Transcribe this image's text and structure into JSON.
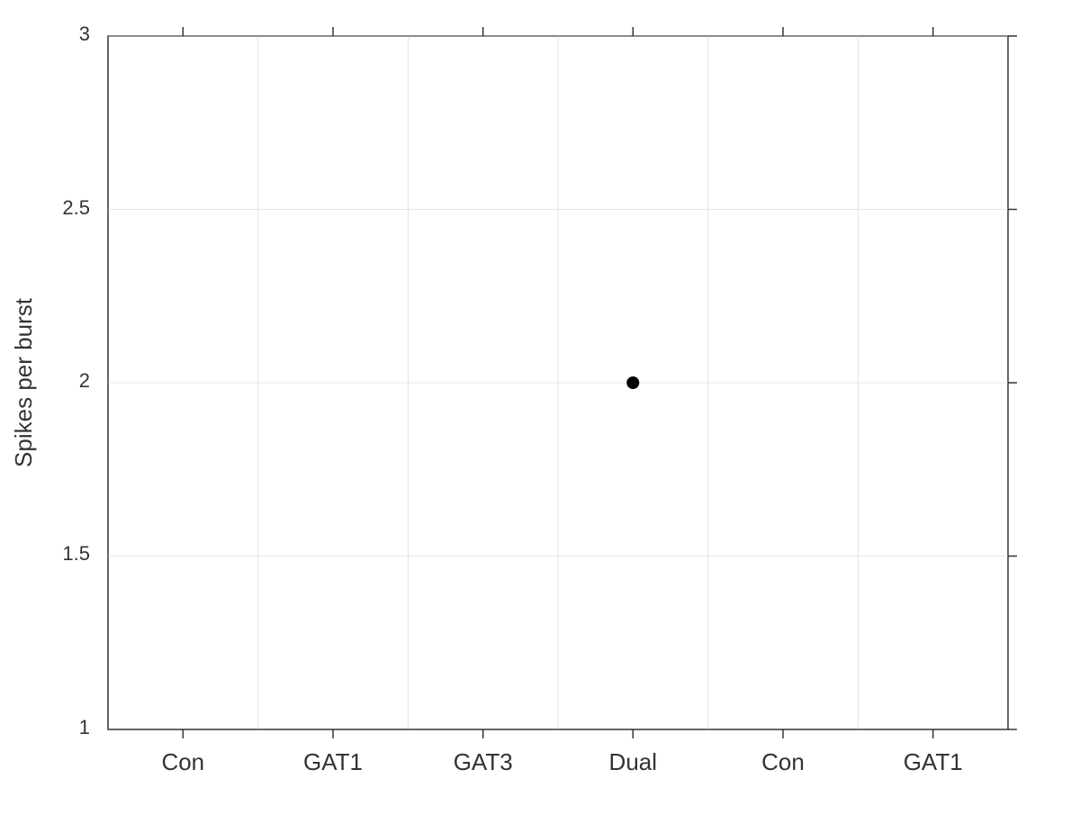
{
  "chart": {
    "title": "",
    "y_axis_label": "Spikes per burst",
    "x_axis_labels": [
      "Con",
      "GAT1",
      "GAT3",
      "Dual",
      "Con",
      "GAT1"
    ],
    "y_axis_ticks": [
      "1",
      "1.5",
      "2",
      "2.5",
      "3"
    ],
    "data_points": [
      {
        "x_index": 3,
        "y_value": 2.0,
        "x_label": "Dual"
      }
    ],
    "y_min": 1,
    "y_max": 3,
    "colors": {
      "axis": "#333333",
      "grid": "#cccccc",
      "data_point": "#000000",
      "label": "#333333"
    }
  }
}
